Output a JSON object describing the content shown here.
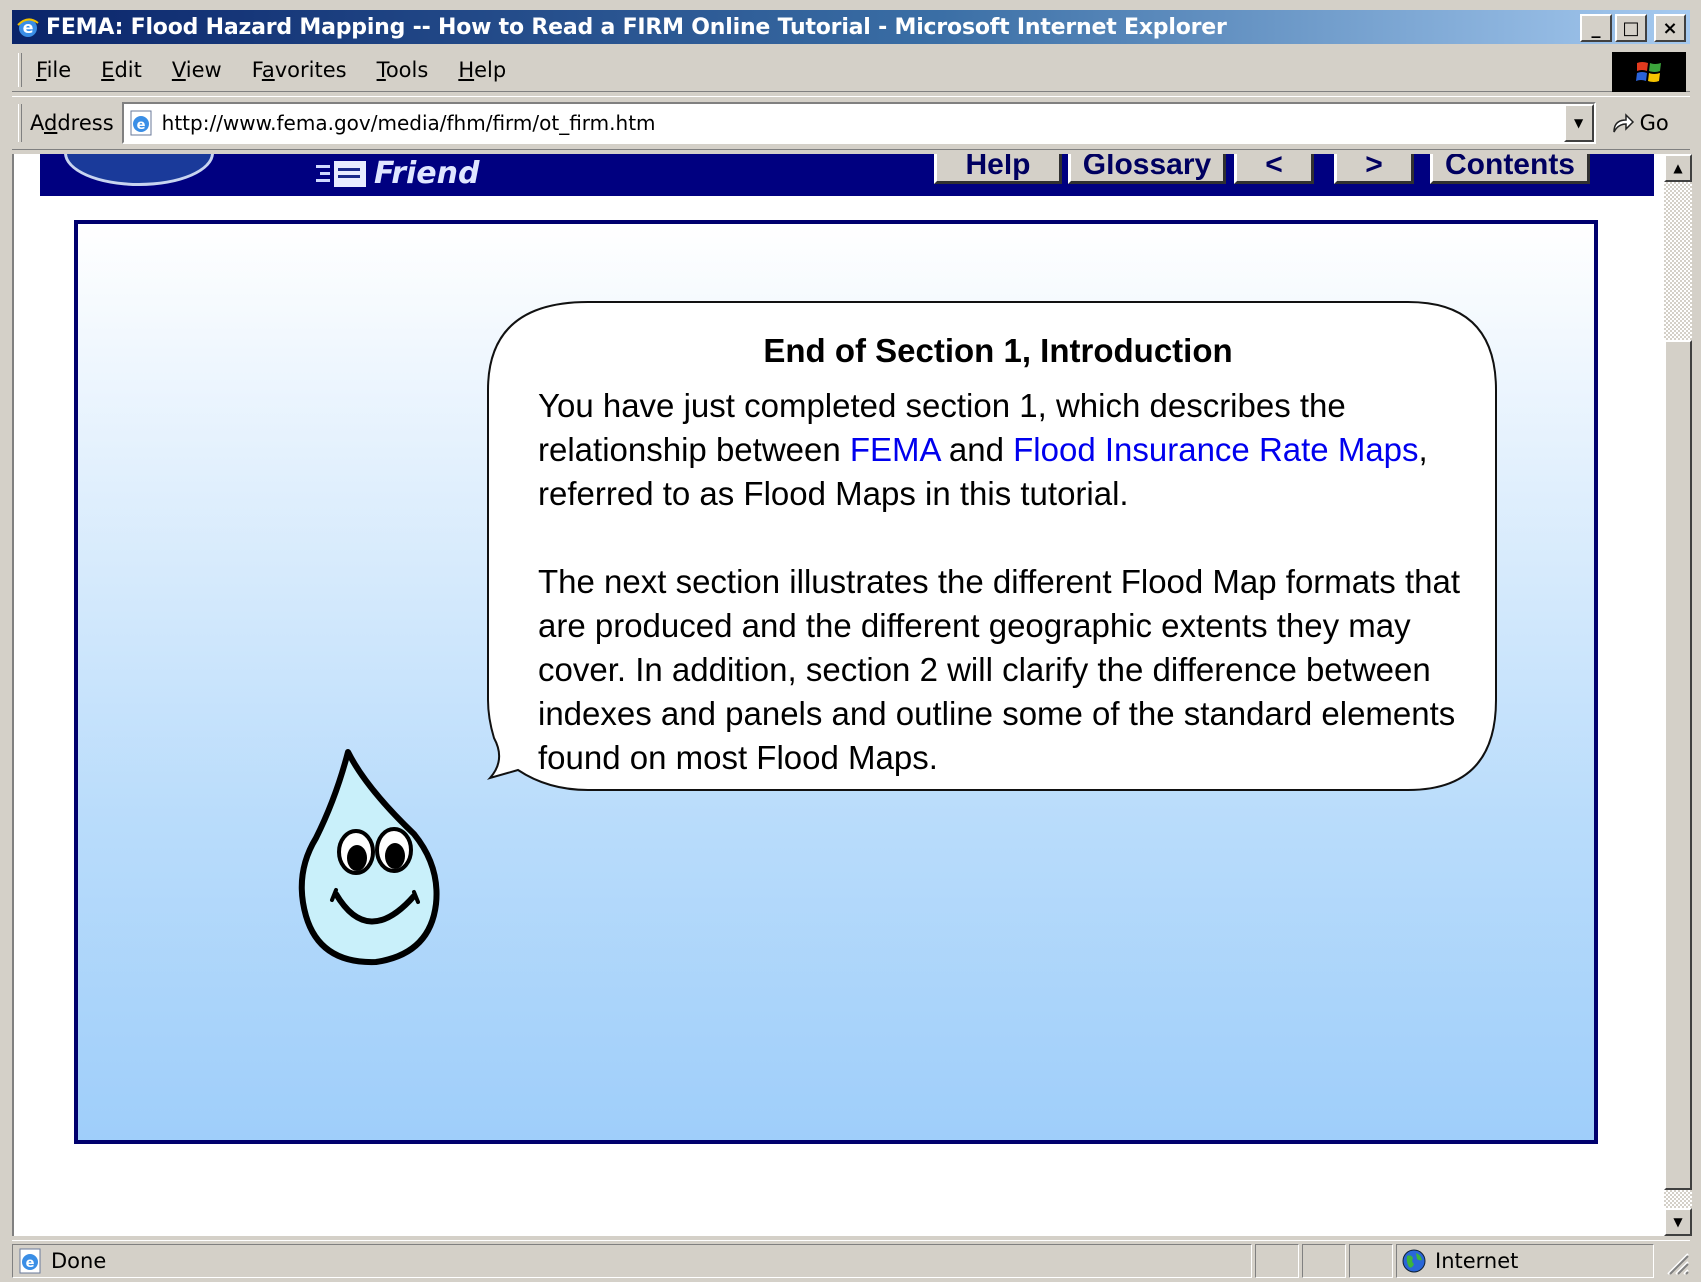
{
  "window": {
    "title": "FEMA: Flood Hazard Mapping -- How to Read a FIRM Online Tutorial - Microsoft Internet Explorer",
    "minimize_glyph": "_",
    "maximize_glyph": "□",
    "close_glyph": "×"
  },
  "menu": {
    "file": {
      "key": "F",
      "rest": "ile"
    },
    "edit": {
      "key": "E",
      "rest": "dit"
    },
    "view": {
      "key": "V",
      "rest": "iew"
    },
    "favorites": {
      "pre": "F",
      "key": "a",
      "rest": "vorites"
    },
    "tools": {
      "key": "T",
      "rest": "ools"
    },
    "help": {
      "key": "H",
      "rest": "elp"
    }
  },
  "address": {
    "label_pre": "A",
    "label_key": "d",
    "label_rest": "dress",
    "url": "http://www.fema.gov/media/fhm/firm/ot_firm.htm",
    "go_label": "Go"
  },
  "site_header": {
    "friend_text": "Friend",
    "nav": {
      "help": "Help",
      "glossary": "Glossary",
      "prev": "<",
      "next": ">",
      "contents": "Contents"
    }
  },
  "content": {
    "heading": "End of Section 1, Introduction",
    "para1": {
      "text1": "You have just completed section 1, which describes the relationship between ",
      "link1": "FEMA",
      "text2": " and ",
      "link2": "Flood Insurance Rate Maps",
      "text3": ", referred to as Flood Maps in this tutorial."
    },
    "para2": "The next section illustrates the different Flood Map formats that are produced and the different geographic extents they may cover. In addition, section 2 will clarify the difference between indexes and panels and outline some of the standard elements found on most Flood Maps."
  },
  "status": {
    "text": "Done",
    "zone": "Internet"
  },
  "colors": {
    "header_navy": "#000080",
    "link_blue": "#0000ee",
    "content_border": "#00006e",
    "gradient_bottom": "#9fcefa",
    "drop_fill": "#c9f0fa"
  }
}
